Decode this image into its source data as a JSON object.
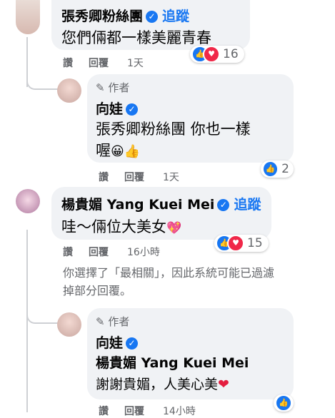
{
  "comment1": {
    "name": "張秀卿粉絲團",
    "follow": "追蹤",
    "text": "您們倆都一樣美麗青春",
    "actions": {
      "like": "讚",
      "reply": "回覆",
      "time": "1天"
    },
    "reaction_count": "16"
  },
  "reply1": {
    "author_badge": "作者",
    "name": "向娃",
    "text_line1": "張秀卿粉絲團 你也一樣",
    "text_line2": "喔",
    "emoji": "😀👍",
    "actions": {
      "like": "讚",
      "reply": "回覆",
      "time": "1天"
    },
    "reaction_count": "2"
  },
  "comment2": {
    "name": "楊貴媚 Yang Kuei Mei",
    "follow": "追蹤",
    "text": "哇～倆位大美女",
    "emoji": "💖",
    "actions": {
      "like": "讚",
      "reply": "回覆",
      "time": "16小時"
    },
    "reaction_count": "15"
  },
  "notice": {
    "line1": "你選擇了「最相關」，因此系統可能已過濾",
    "line2": "掉部分回覆。"
  },
  "reply2": {
    "author_badge": "作者",
    "name": "向娃",
    "mention": "楊貴媚 Yang Kuei Mei",
    "text": "謝謝貴媚，人美心美",
    "emoji": "❤",
    "actions": {
      "like": "讚",
      "reply": "回覆",
      "time": "14小時"
    }
  }
}
